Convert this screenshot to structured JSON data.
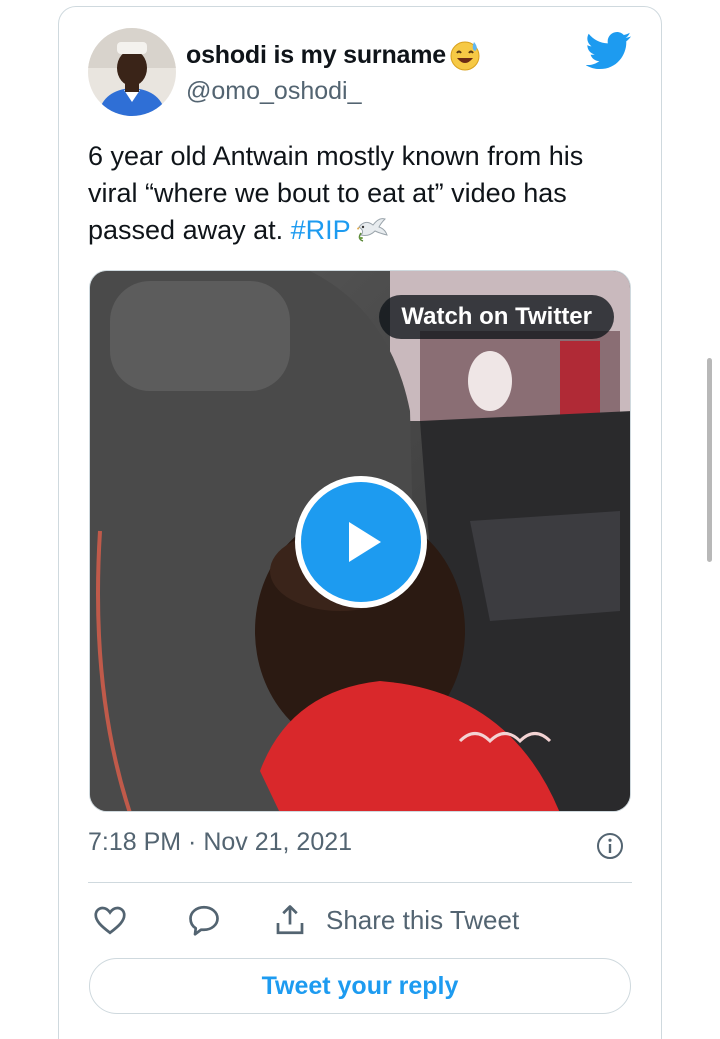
{
  "author": {
    "display_name": "oshodi is my surname",
    "handle": "@omo_oshodi_",
    "name_emoji": "smiling-face-with-sweat-icon"
  },
  "tweet": {
    "text_part1": "6 year old Antwain mostly known from his viral “where we bout to eat at” video has passed away at. ",
    "hashtag": "#RIP",
    "trailing_emoji": "dove-icon"
  },
  "media": {
    "overlay_label": "Watch on Twitter",
    "type": "video"
  },
  "meta": {
    "timestamp": "7:18 PM · Nov 21, 2021"
  },
  "actions": {
    "share_label": "Share this Tweet"
  },
  "reply": {
    "label": "Tweet your reply"
  },
  "colors": {
    "accent": "#1d9bf0",
    "secondary_text": "#536471",
    "border": "#cfd9de"
  }
}
